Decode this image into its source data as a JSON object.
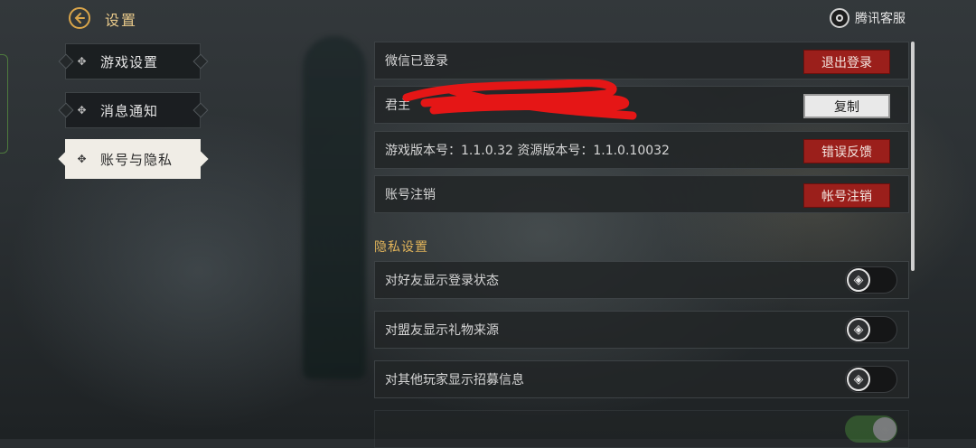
{
  "header": {
    "title": "设置",
    "customer_service": "腾讯客服",
    "back_icon": "back-arrow-icon",
    "cs_icon": "customer-service-icon"
  },
  "sidebar": {
    "tabs": [
      {
        "label": "游戏设置",
        "active": false
      },
      {
        "label": "消息通知",
        "active": false
      },
      {
        "label": "账号与隐私",
        "active": true
      }
    ]
  },
  "account": {
    "wechat_status": "微信已登录",
    "logout_button": "退出登录",
    "lord_id_label": "君主",
    "lord_id_value_suffix": "...",
    "copy_button": "复制",
    "version_text": "游戏版本号：1.1.0.32   资源版本号：1.1.0.10032",
    "feedback_button": "错误反馈",
    "cancel_account_label": "账号注销",
    "cancel_account_button": "帐号注销"
  },
  "privacy": {
    "section_title": "隐私设置",
    "items": [
      {
        "label": "对好友显示登录状态",
        "on": false
      },
      {
        "label": "对盟友显示礼物来源",
        "on": false
      },
      {
        "label": "对其他玩家显示招募信息",
        "on": false
      },
      {
        "label": "",
        "on": true
      }
    ]
  },
  "colors": {
    "accent_gold": "#e0b35a",
    "danger_red": "#9b1f1b",
    "toggle_on_green": "#4a8f3a"
  }
}
